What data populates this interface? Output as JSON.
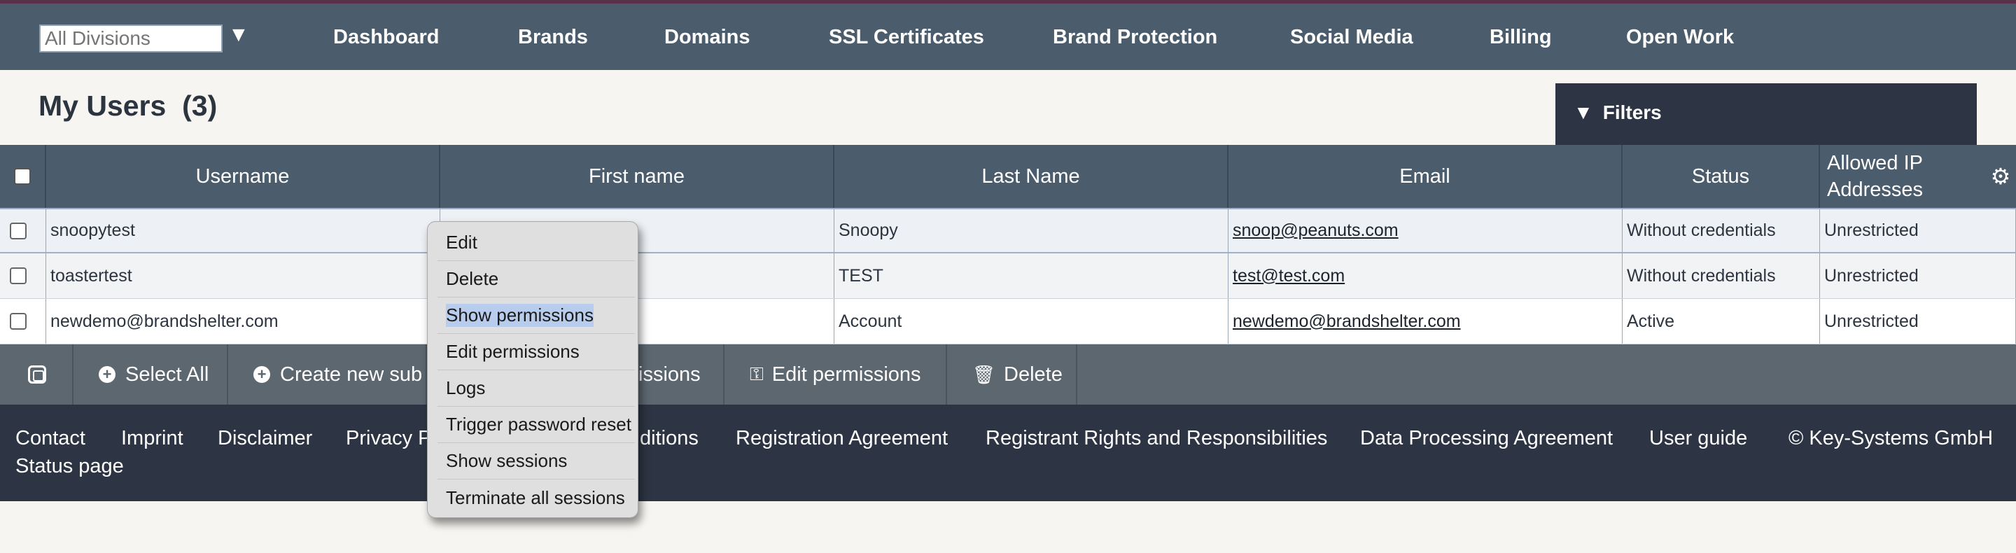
{
  "division_select": {
    "placeholder": "All Divisions"
  },
  "nav": [
    {
      "label": "Dashboard"
    },
    {
      "label": "Brands"
    },
    {
      "label": "Domains"
    },
    {
      "label": "SSL Certificates"
    },
    {
      "label": "Brand Protection"
    },
    {
      "label": "Social Media"
    },
    {
      "label": "Billing"
    },
    {
      "label": "Open Work"
    }
  ],
  "page": {
    "title": "My Users",
    "count": "(3)"
  },
  "filters": {
    "label": "Filters"
  },
  "table": {
    "columns": [
      "Username",
      "First name",
      "Last Name",
      "Email",
      "Status",
      "Allowed IP Addresses"
    ],
    "rows": [
      {
        "username": "snoopytest",
        "first_name": "",
        "last_name": "Snoopy",
        "email": "snoop@peanuts.com",
        "status": "Without credentials",
        "allowed_ip": "Unrestricted"
      },
      {
        "username": "toastertest",
        "first_name": "",
        "last_name": "TEST",
        "email": "test@test.com",
        "status": "Without credentials",
        "allowed_ip": "Unrestricted"
      },
      {
        "username": "newdemo@brandshelter.com",
        "first_name": "",
        "last_name": "Account",
        "email": "newdemo@brandshelter.com",
        "status": "Active",
        "allowed_ip": "Unrestricted"
      }
    ]
  },
  "actions": {
    "select_all": "Select All",
    "create_new": "Create new sub",
    "permissions_partial": "issions",
    "edit_permissions": "Edit permissions",
    "delete": "Delete"
  },
  "footer": {
    "links": [
      "Contact",
      "Imprint",
      "Disclaimer",
      "Privacy P",
      "ditions",
      "Registration Agreement",
      "Registrant Rights and Responsibilities",
      "Data Processing Agreement",
      "User guide",
      "© Key-Systems GmbH"
    ],
    "status_page": "Status page"
  },
  "context_menu": {
    "items": [
      "Edit",
      "Delete",
      "Show permissions",
      "Edit permissions",
      "Logs",
      "Trigger password reset",
      "Show sessions",
      "Terminate all sessions"
    ],
    "highlighted": "Show permissions"
  },
  "colors": {
    "topbar": "#4b5c6d",
    "footer": "#2d3544",
    "actionbar": "#5c6770",
    "highlight": "#b8cdee"
  }
}
